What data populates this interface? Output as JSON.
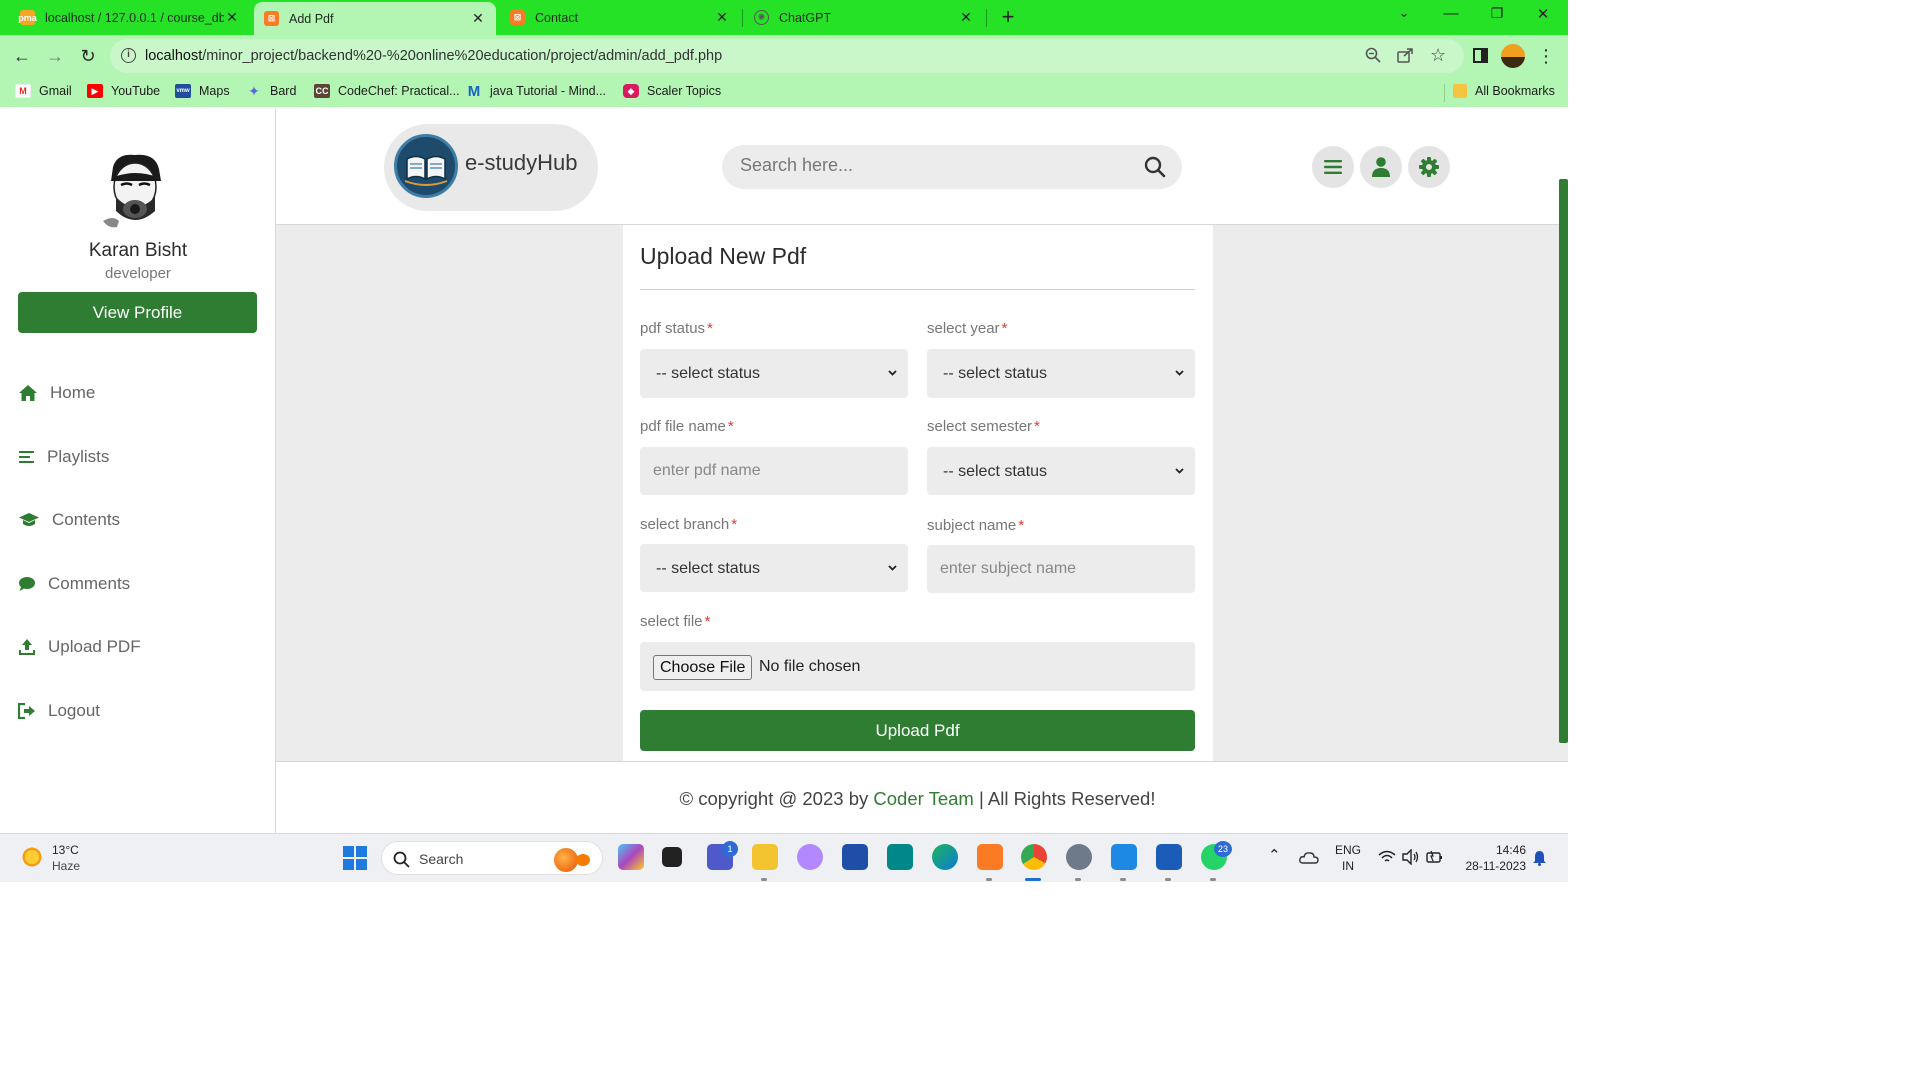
{
  "browser": {
    "tabs": [
      {
        "title": "localhost / 127.0.0.1 / course_db",
        "icon": "phpmyadmin-icon"
      },
      {
        "title": "Add Pdf",
        "icon": "xampp-icon",
        "active": true
      },
      {
        "title": "Contact",
        "icon": "xampp-icon"
      },
      {
        "title": "ChatGPT",
        "icon": "chatgpt-icon"
      }
    ],
    "url_host": "localhost",
    "url_path": "/minor_project/backend%20-%20online%20education/project/admin/add_pdf.php",
    "bookmarks": [
      {
        "label": "Gmail",
        "icon": "gmail-icon"
      },
      {
        "label": "YouTube",
        "icon": "youtube-icon"
      },
      {
        "label": "Maps",
        "icon": "maps-icon"
      },
      {
        "label": "Bard",
        "icon": "bard-icon"
      },
      {
        "label": "CodeChef: Practical...",
        "icon": "codechef-icon"
      },
      {
        "label": "java Tutorial - Mind...",
        "icon": "mindmajix-icon"
      },
      {
        "label": "Scaler Topics",
        "icon": "scaler-icon"
      }
    ],
    "all_bookmarks": "All Bookmarks",
    "theme_color": "#26e226",
    "toolbar_color": "#b3f5b3"
  },
  "sidebar": {
    "name": "Karan Bisht",
    "role": "developer",
    "view_profile": "View Profile",
    "nav": [
      {
        "label": "Home",
        "icon": "home-icon"
      },
      {
        "label": "Playlists",
        "icon": "list-icon"
      },
      {
        "label": "Contents",
        "icon": "graduation-cap-icon"
      },
      {
        "label": "Comments",
        "icon": "comment-icon"
      },
      {
        "label": "Upload PDF",
        "icon": "upload-icon"
      },
      {
        "label": "Logout",
        "icon": "logout-icon"
      }
    ]
  },
  "header": {
    "logo_text": "e-studyHub",
    "search_placeholder": "Search here...",
    "icons": [
      "menu-icon",
      "user-icon",
      "settings-icon"
    ]
  },
  "form": {
    "title": "Upload New Pdf",
    "fields": {
      "pdf_status": {
        "label": "pdf status",
        "value": "-- select status"
      },
      "select_year": {
        "label": "select year",
        "value": "-- select status"
      },
      "pdf_file_name": {
        "label": "pdf file name",
        "placeholder": "enter pdf name"
      },
      "select_semester": {
        "label": "select semester",
        "value": "-- select status"
      },
      "select_branch": {
        "label": "select branch",
        "value": "-- select status"
      },
      "subject_name": {
        "label": "subject name",
        "placeholder": "enter subject name"
      },
      "select_file": {
        "label": "select file",
        "button": "Choose File",
        "status": "No file chosen"
      }
    },
    "required_mark": "*",
    "submit": "Upload Pdf"
  },
  "footer": {
    "prefix": "© copyright @ 2023 by",
    "team": "Coder Team",
    "suffix": "| All Rights Reserved!"
  },
  "accent_color": "#2e7d32",
  "taskbar": {
    "temperature": "13°C",
    "weather": "Haze",
    "search": "Search",
    "teams_badge": "1",
    "whatsapp_badge": "23",
    "lang_line1": "ENG",
    "lang_line2": "IN",
    "time": "14:46",
    "date": "28-11-2023"
  }
}
